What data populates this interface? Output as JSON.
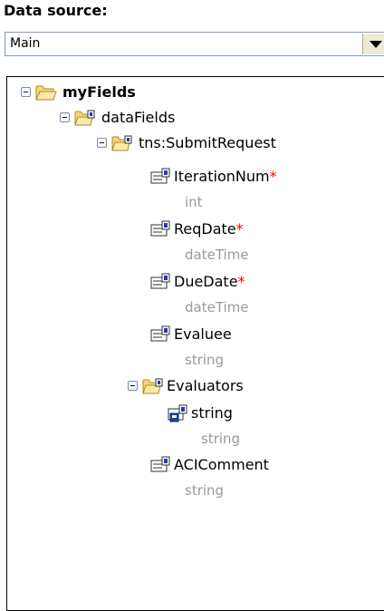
{
  "data_source": {
    "heading": "Data source:",
    "selected": "Main"
  },
  "tree": {
    "root": {
      "label": "myFields",
      "icon": "open-folder-icon"
    },
    "dataFields": {
      "label": "dataFields",
      "icon": "group-folder-icon"
    },
    "submitRequest": {
      "label": "tns:SubmitRequest",
      "icon": "group-folder-icon"
    },
    "fields": [
      {
        "label": "IterationNum",
        "required": "*",
        "type": "int"
      },
      {
        "label": "ReqDate",
        "required": "*",
        "type": "dateTime"
      },
      {
        "label": "DueDate",
        "required": "*",
        "type": "dateTime"
      },
      {
        "label": "Evaluee",
        "required": "",
        "type": "string"
      }
    ],
    "evaluators": {
      "label": "Evaluators",
      "child": {
        "label": "string",
        "type": "string"
      }
    },
    "aciComment": {
      "label": "ACIComment",
      "type": "string"
    }
  }
}
